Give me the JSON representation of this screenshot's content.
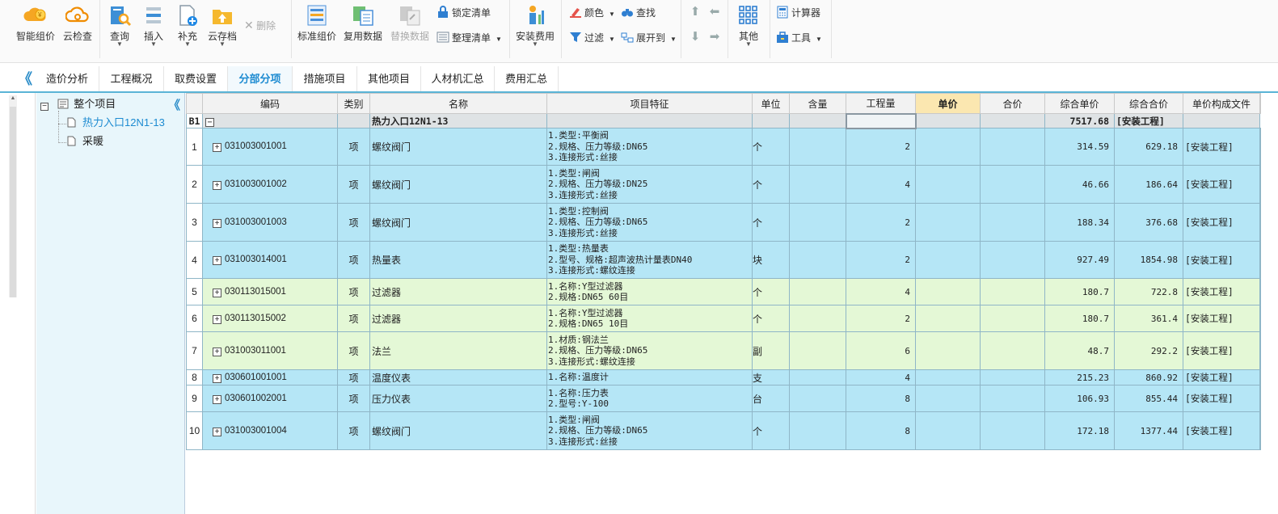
{
  "toolbar": {
    "smart_pricing": "智能组价",
    "cloud_check": "云检查",
    "query": "查询",
    "insert": "插入",
    "supplement": "补充",
    "cloud_save": "云存档",
    "delete": "删除",
    "standard_pricing": "标准组价",
    "reuse_data": "复用数据",
    "replace_data": "替换数据",
    "lock_list": "锁定清单",
    "organize_list": "整理清单",
    "install_cost": "安装费用",
    "color": "颜色",
    "find": "查找",
    "filter": "过滤",
    "expand_to": "展开到",
    "other": "其他",
    "calculator": "计算器",
    "tools": "工具"
  },
  "tabs": [
    "造价分析",
    "工程概况",
    "取费设置",
    "分部分项",
    "措施项目",
    "其他项目",
    "人材机汇总",
    "费用汇总"
  ],
  "active_tab": "分部分项",
  "tree": {
    "root": "整个项目",
    "items": [
      "热力入口12N1-13",
      "采暖"
    ]
  },
  "columns": [
    "编码",
    "类别",
    "名称",
    "项目特征",
    "单位",
    "含量",
    "工程量",
    "单价",
    "合价",
    "综合单价",
    "综合合价",
    "单价构成文件"
  ],
  "group_row": {
    "label": "B1",
    "name": "热力入口12N1-13",
    "total": "7517.68",
    "file": "[安装工程]"
  },
  "rows": [
    {
      "no": "1",
      "code": "031003001001",
      "type": "项",
      "name": "螺纹阀门",
      "features": [
        "1.类型:平衡阀",
        "2.规格、压力等级:DN65",
        "3.连接形式:丝接"
      ],
      "unit": "个",
      "qty": "2",
      "unit_price": "314.59",
      "total": "629.18",
      "file": "[安装工程]"
    },
    {
      "no": "2",
      "code": "031003001002",
      "type": "项",
      "name": "螺纹阀门",
      "features": [
        "1.类型:闸阀",
        "2.规格、压力等级:DN25",
        "3.连接形式:丝接"
      ],
      "unit": "个",
      "qty": "4",
      "unit_price": "46.66",
      "total": "186.64",
      "file": "[安装工程]"
    },
    {
      "no": "3",
      "code": "031003001003",
      "type": "项",
      "name": "螺纹阀门",
      "features": [
        "1.类型:控制阀",
        "2.规格、压力等级:DN65",
        "3.连接形式:丝接"
      ],
      "unit": "个",
      "qty": "2",
      "unit_price": "188.34",
      "total": "376.68",
      "file": "[安装工程]"
    },
    {
      "no": "4",
      "code": "031003014001",
      "type": "项",
      "name": "热量表",
      "features": [
        "1.类型:热量表",
        "2.型号、规格:超声波热计量表DN40",
        "3.连接形式:螺纹连接"
      ],
      "unit": "块",
      "qty": "2",
      "unit_price": "927.49",
      "total": "1854.98",
      "file": "[安装工程]"
    },
    {
      "no": "5",
      "code": "030113015001",
      "type": "项",
      "name": "过滤器",
      "features": [
        "1.名称:Y型过滤器",
        "2.规格:DN65 60目"
      ],
      "unit": "个",
      "qty": "4",
      "unit_price": "180.7",
      "total": "722.8",
      "file": "[安装工程]"
    },
    {
      "no": "6",
      "code": "030113015002",
      "type": "项",
      "name": "过滤器",
      "features": [
        "1.名称:Y型过滤器",
        "2.规格:DN65 10目"
      ],
      "unit": "个",
      "qty": "2",
      "unit_price": "180.7",
      "total": "361.4",
      "file": "[安装工程]"
    },
    {
      "no": "7",
      "code": "031003011001",
      "type": "项",
      "name": "法兰",
      "features": [
        "1.材质:钢法兰",
        "2.规格、压力等级:DN65",
        "3.连接形式:螺纹连接"
      ],
      "unit": "副",
      "qty": "6",
      "unit_price": "48.7",
      "total": "292.2",
      "file": "[安装工程]"
    },
    {
      "no": "8",
      "code": "030601001001",
      "type": "项",
      "name": "温度仪表",
      "features": [
        "1.名称:温度计"
      ],
      "unit": "支",
      "qty": "4",
      "unit_price": "215.23",
      "total": "860.92",
      "file": "[安装工程]"
    },
    {
      "no": "9",
      "code": "030601002001",
      "type": "项",
      "name": "压力仪表",
      "features": [
        "1.名称:压力表",
        "2.型号:Y-100"
      ],
      "unit": "台",
      "qty": "8",
      "unit_price": "106.93",
      "total": "855.44",
      "file": "[安装工程]"
    },
    {
      "no": "10",
      "code": "031003001004",
      "type": "项",
      "name": "螺纹阀门",
      "features": [
        "1.类型:闸阀",
        "2.规格、压力等级:DN65",
        "3.连接形式:丝接"
      ],
      "unit": "个",
      "qty": "8",
      "unit_price": "172.18",
      "total": "1377.44",
      "file": "[安装工程]"
    }
  ],
  "row_colors": {
    "blue": "#b5e6f6",
    "green": "#e4f8d6",
    "accent": "#1d8bd1"
  }
}
